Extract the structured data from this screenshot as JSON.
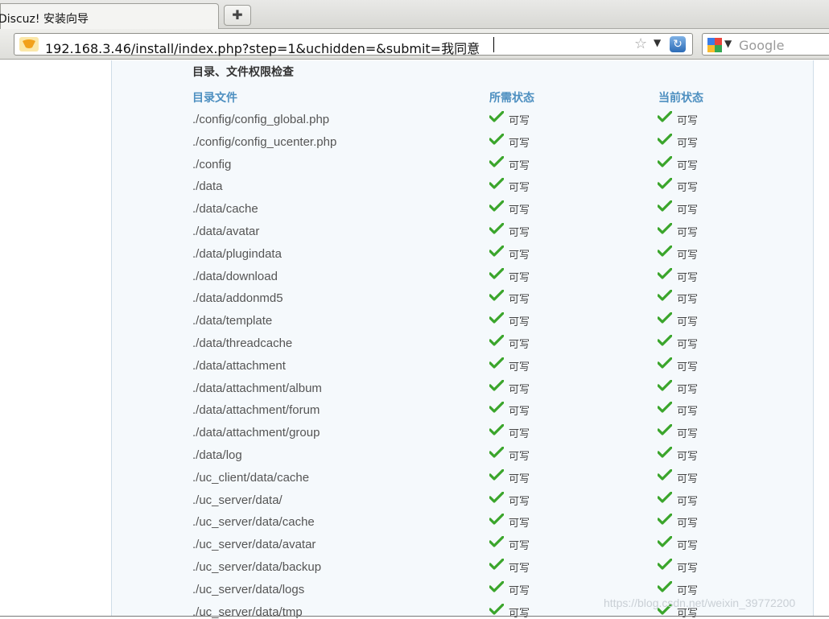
{
  "browser": {
    "tab_title": "Discuz! 安装向导",
    "new_tab_symbol": "✚",
    "url": "192.168.3.46/install/index.php?step=1&uchidden=&submit=我同意",
    "search_placeholder": "Google",
    "site_icon": "site-identity-icon",
    "reload_icon": "reload-icon"
  },
  "page": {
    "section_title": "目录、文件权限检查",
    "columns": {
      "path": "目录文件",
      "required": "所需状态",
      "current": "当前状态"
    },
    "rows": [
      {
        "path": "./config/config_global.php",
        "required": "可写",
        "current": "可写"
      },
      {
        "path": "./config/config_ucenter.php",
        "required": "可写",
        "current": "可写"
      },
      {
        "path": "./config",
        "required": "可写",
        "current": "可写"
      },
      {
        "path": "./data",
        "required": "可写",
        "current": "可写"
      },
      {
        "path": "./data/cache",
        "required": "可写",
        "current": "可写"
      },
      {
        "path": "./data/avatar",
        "required": "可写",
        "current": "可写"
      },
      {
        "path": "./data/plugindata",
        "required": "可写",
        "current": "可写"
      },
      {
        "path": "./data/download",
        "required": "可写",
        "current": "可写"
      },
      {
        "path": "./data/addonmd5",
        "required": "可写",
        "current": "可写"
      },
      {
        "path": "./data/template",
        "required": "可写",
        "current": "可写"
      },
      {
        "path": "./data/threadcache",
        "required": "可写",
        "current": "可写"
      },
      {
        "path": "./data/attachment",
        "required": "可写",
        "current": "可写"
      },
      {
        "path": "./data/attachment/album",
        "required": "可写",
        "current": "可写"
      },
      {
        "path": "./data/attachment/forum",
        "required": "可写",
        "current": "可写"
      },
      {
        "path": "./data/attachment/group",
        "required": "可写",
        "current": "可写"
      },
      {
        "path": "./data/log",
        "required": "可写",
        "current": "可写"
      },
      {
        "path": "./uc_client/data/cache",
        "required": "可写",
        "current": "可写"
      },
      {
        "path": "./uc_server/data/",
        "required": "可写",
        "current": "可写"
      },
      {
        "path": "./uc_server/data/cache",
        "required": "可写",
        "current": "可写"
      },
      {
        "path": "./uc_server/data/avatar",
        "required": "可写",
        "current": "可写"
      },
      {
        "path": "./uc_server/data/backup",
        "required": "可写",
        "current": "可写"
      },
      {
        "path": "./uc_server/data/logs",
        "required": "可写",
        "current": "可写"
      },
      {
        "path": "./uc_server/data/tmp",
        "required": "可写",
        "current": "可写"
      }
    ],
    "status_icon": "check-icon",
    "check_color": "#3aa52b",
    "watermark": "https://blog.csdn.net/weixin_39772200"
  }
}
